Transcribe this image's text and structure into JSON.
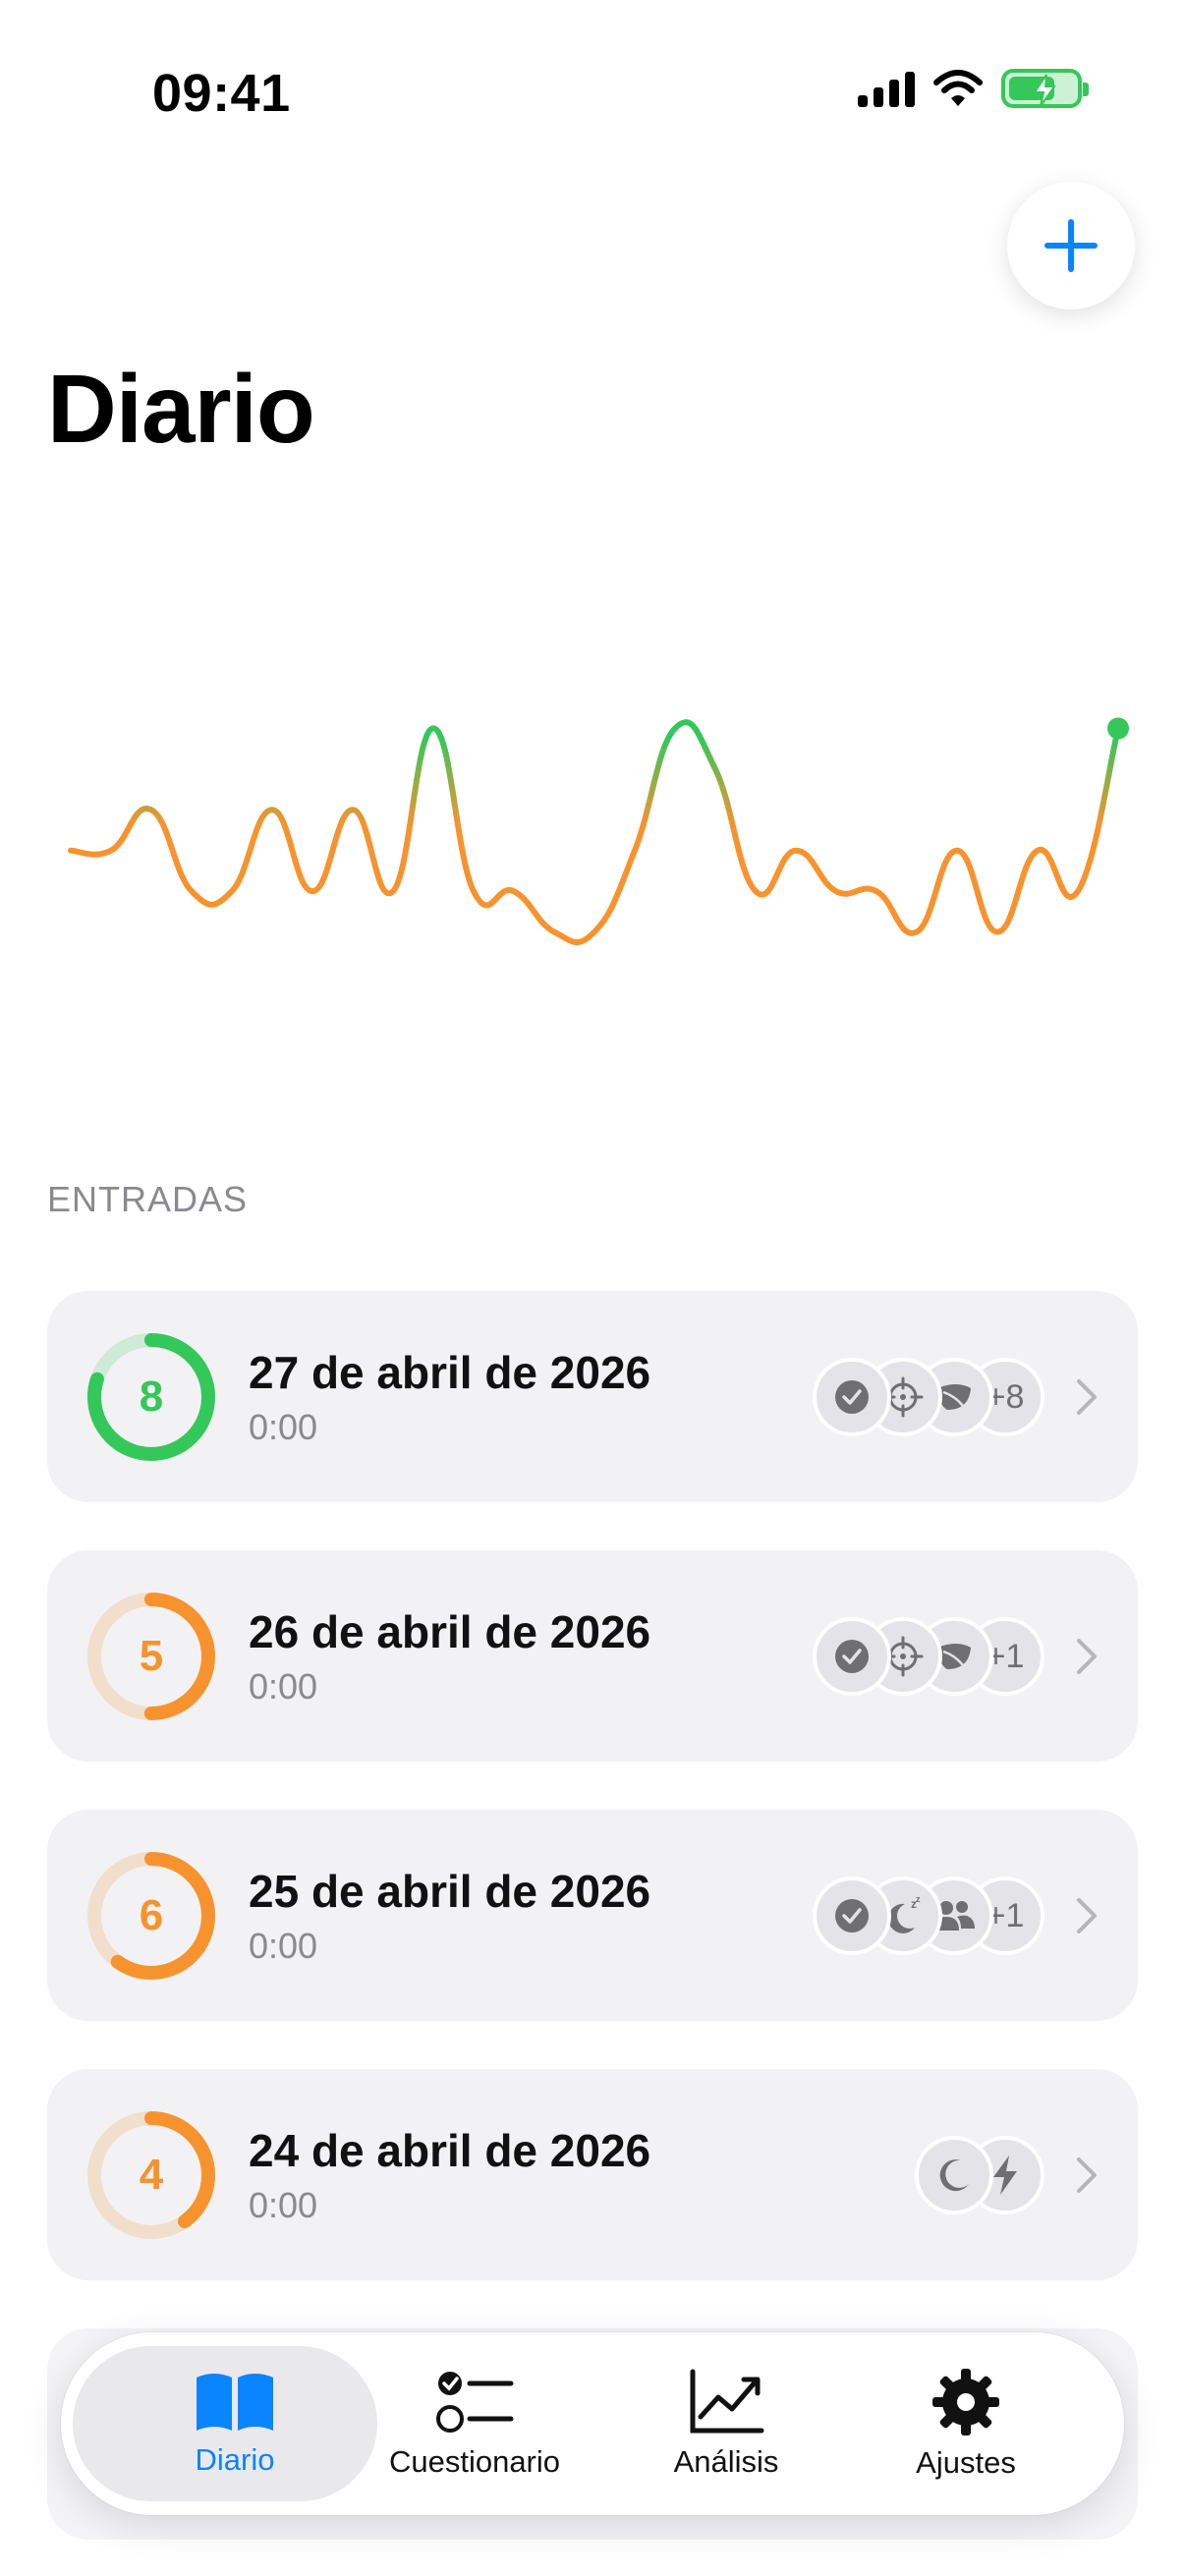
{
  "status_bar": {
    "time": "09:41"
  },
  "header": {
    "title": "Diario",
    "add_button_icon": "plus-icon"
  },
  "chart_data": {
    "type": "line",
    "x": [
      0,
      1,
      2,
      3,
      4,
      5,
      6,
      7,
      8,
      9,
      10,
      11,
      12,
      13,
      14,
      15,
      16,
      17,
      18,
      19,
      20,
      21,
      22,
      23,
      24,
      25,
      26
    ],
    "series": [
      {
        "values": [
          5,
          5,
          6,
          4,
          4,
          6,
          4,
          6,
          4,
          8,
          4,
          4,
          3,
          3,
          5,
          8,
          7,
          4,
          5,
          4,
          4,
          3,
          5,
          3,
          5,
          4,
          8
        ]
      }
    ],
    "ylim": [
      2,
      9
    ],
    "grid": false,
    "colors": {
      "low": "#f7932f",
      "high": "#34c759"
    }
  },
  "section": {
    "title": "ENTRADAS"
  },
  "entries": [
    {
      "value": "8",
      "date": "27 de abril de 2026",
      "time": "0:00",
      "color": "#34c759",
      "fraction": 0.8,
      "tags": [
        "check-circle-icon",
        "target-icon",
        "leaf-icon"
      ],
      "more": "+8"
    },
    {
      "value": "5",
      "date": "26 de abril de 2026",
      "time": "0:00",
      "color": "#f7932f",
      "fraction": 0.5,
      "tags": [
        "check-circle-icon",
        "target-icon",
        "leaf-icon"
      ],
      "more": "+1"
    },
    {
      "value": "6",
      "date": "25 de abril de 2026",
      "time": "0:00",
      "color": "#f7932f",
      "fraction": 0.6,
      "tags": [
        "check-circle-icon",
        "moon-zzz-icon",
        "people-icon"
      ],
      "more": "+1"
    },
    {
      "value": "4",
      "date": "24 de abril de 2026",
      "time": "0:00",
      "color": "#f7932f",
      "fraction": 0.4,
      "tags": [
        "moon-icon",
        "bolt-icon"
      ],
      "more": ""
    }
  ],
  "tabbar": {
    "tabs": [
      {
        "label": "Diario",
        "icon": "book-icon",
        "active": true
      },
      {
        "label": "Cuestionario",
        "icon": "checklist-icon",
        "active": false
      },
      {
        "label": "Análisis",
        "icon": "chart-line-icon",
        "active": false
      },
      {
        "label": "Ajustes",
        "icon": "gear-icon",
        "active": false
      }
    ]
  },
  "accent": "#0a84ff"
}
